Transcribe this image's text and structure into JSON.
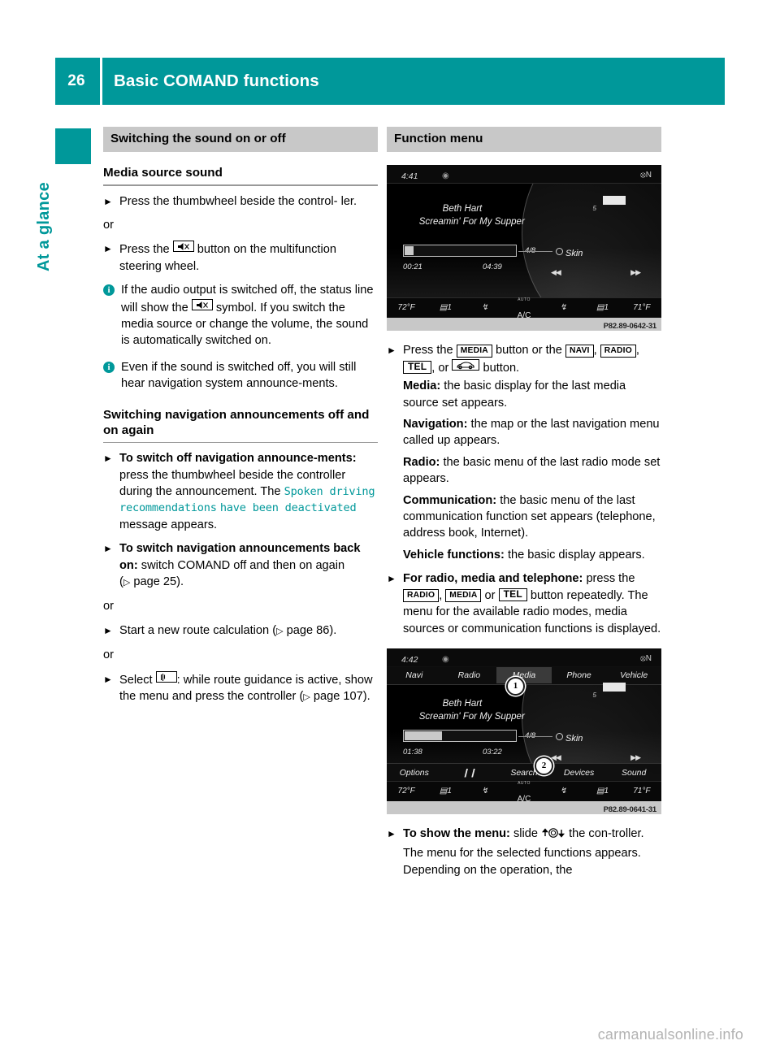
{
  "header": {
    "page_number": "26",
    "title": "Basic COMAND functions"
  },
  "sidebar": {
    "tab_label": "At a glance"
  },
  "left_column": {
    "section_title": "Switching the sound on or off",
    "sub_head_1": "Media source sound",
    "step_1": "Press the thumbwheel beside the control-",
    "step_1_cont": "ler.",
    "or_1": "or",
    "step_2_pre": "Press the",
    "step_2_post": "button on the multifunction",
    "step_2_cont": "steering wheel.",
    "note_1_pre": "If the audio output is switched off, the status line will show the",
    "note_1_post": "symbol. If you switch the media source or change the volume, the sound is automatically switched on.",
    "note_2": "Even if the sound is switched off, you will still hear navigation system announce-ments.",
    "sub_head_2": "Switching navigation announcements off and on again",
    "step_3_bold": "To switch off navigation announce-ments:",
    "step_3_text": "press the thumbwheel beside the controller during the announcement.",
    "step_3_the": "The",
    "step_3_msg_line1": "Spoken driving recommendations",
    "step_3_msg_line2": "have been deactivated",
    "step_3_tail": "message appears.",
    "step_4_bold": "To switch navigation announcements back on:",
    "step_4_text": "switch COMAND off and then on again (",
    "step_4_pageref": "page 25",
    "step_4_tail": ").",
    "or_2": "or",
    "step_5_text": "Start a new route calculation (",
    "step_5_pageref": "page 86",
    "step_5_tail": ").",
    "or_3": "or",
    "step_6_pre": "Select",
    "step_6_post": ": while route guidance is active, show the menu and press the controller (",
    "step_6_pageref": "page 107",
    "step_6_tail": ")."
  },
  "right_column": {
    "section_title": "Function menu",
    "step_1_pre": "Press the",
    "step_1_key_media": "MEDIA",
    "step_1_mid": "button or the",
    "step_1_key_navi": "NAVI",
    "step_1_key_radio": "RADIO",
    "step_1_key_tel": "TEL",
    "step_1_or": ", or",
    "step_1_post": "button.",
    "def_media_label": "Media:",
    "def_media_text": "the basic display for the last media source set appears.",
    "def_nav_label": "Navigation:",
    "def_nav_text": "the map or the last navigation menu called up appears.",
    "def_radio_label": "Radio:",
    "def_radio_text": "the basic menu of the last radio mode set appears.",
    "def_comm_label": "Communication:",
    "def_comm_text": "the basic menu of the last communication function set appears (telephone, address book, Internet).",
    "def_veh_label": "Vehicle functions:",
    "def_veh_text": "the basic display appears.",
    "step_2_bold": "For radio, media and telephone:",
    "step_2_text_1": "press the",
    "step_2_key_radio": "RADIO",
    "step_2_key_media": "MEDIA",
    "step_2_or": "or",
    "step_2_key_tel": "TEL",
    "step_2_text_2": "button repeatedly. The menu for the available radio modes, media sources or communication functions is displayed.",
    "step_3_bold": "To show the menu:",
    "step_3_text_1": "slide",
    "step_3_text_2": "the con-troller.",
    "step_3_text_3": "The menu for the selected functions appears. Depending on the operation, the"
  },
  "figures": [
    {
      "caption": "P82.89-0642-31",
      "status_time": "4:41",
      "status_compass": "N",
      "artist": "Beth Hart",
      "track": "Screamin' For My Supper",
      "elapsed": "00:21",
      "total": "04:39",
      "track_number": "4/8",
      "source": "Skin",
      "battery_label": "5",
      "progress_percent": 8,
      "climate": [
        "72°F",
        "1",
        "",
        "A/C",
        "",
        "1",
        "71°F"
      ],
      "climate_ac_label": "A/C",
      "climate_ac_sub": "AUTO",
      "menu_top": [],
      "menu_bottom": [],
      "callouts": []
    },
    {
      "caption": "P82.89-0641-31",
      "status_time": "4:42",
      "status_compass": "N",
      "artist": "Beth Hart",
      "track": "Screamin' For My Supper",
      "elapsed": "01:38",
      "total": "03:22",
      "track_number": "4/8",
      "source": "Skin",
      "battery_label": "5",
      "progress_percent": 33,
      "climate": [
        "72°F",
        "1",
        "",
        "A/C",
        "",
        "1",
        "71°F"
      ],
      "climate_ac_label": "A/C",
      "climate_ac_sub": "AUTO",
      "menu_top": [
        "Navi",
        "Radio",
        "Media",
        "Phone",
        "Vehicle"
      ],
      "menu_top_selected_index": 2,
      "menu_bottom": [
        "Options",
        "",
        "Search",
        "Devices",
        "Sound"
      ],
      "callouts": [
        "1",
        "2"
      ]
    }
  ],
  "footer": {
    "watermark": "carmanualsonline.info"
  }
}
